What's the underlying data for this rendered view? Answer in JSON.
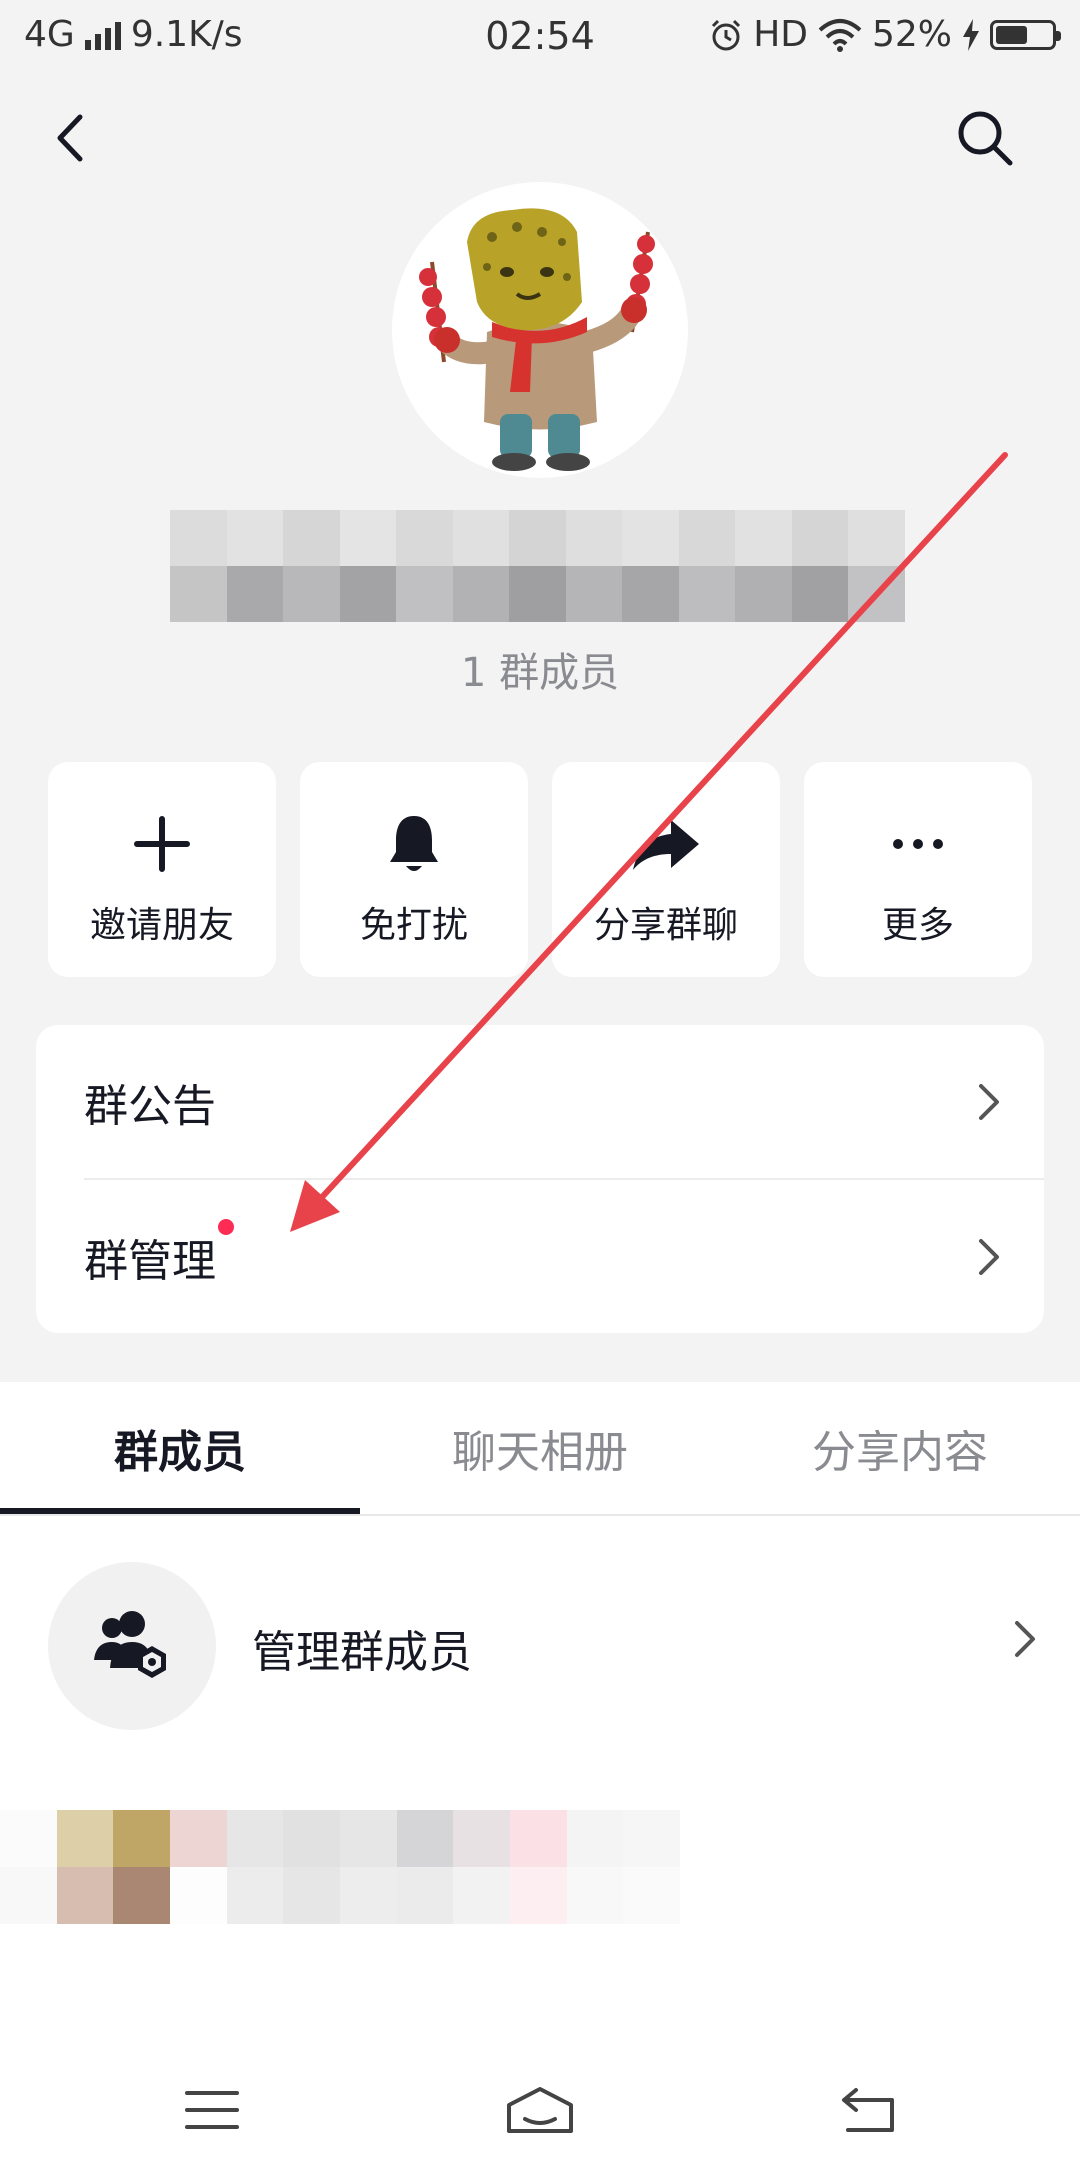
{
  "status_bar": {
    "network": "4G",
    "speed": "9.1K/s",
    "time": "02:54",
    "hd": "HD",
    "battery_percent": "52%",
    "battery_level": 0.52
  },
  "nav": {
    "back_icon": "chevron-left-icon",
    "search_icon": "search-icon"
  },
  "group": {
    "member_count": "1 群成员"
  },
  "actions": [
    {
      "label": "邀请朋友",
      "icon": "plus-icon"
    },
    {
      "label": "免打扰",
      "icon": "bell-icon"
    },
    {
      "label": "分享群聊",
      "icon": "share-arrow-icon"
    },
    {
      "label": "更多",
      "icon": "more-dots-icon"
    }
  ],
  "settings": {
    "announcement": "群公告",
    "management": "群管理"
  },
  "tabs": [
    {
      "label": "群成员",
      "active": true
    },
    {
      "label": "聊天相册",
      "active": false
    },
    {
      "label": "分享内容",
      "active": false
    }
  ],
  "members": {
    "manage_label": "管理群成员"
  },
  "colors": {
    "accent_red": "#fe2c55",
    "arrow_red": "#e8434b",
    "text_primary": "#161823",
    "text_secondary": "#8a8b91"
  }
}
